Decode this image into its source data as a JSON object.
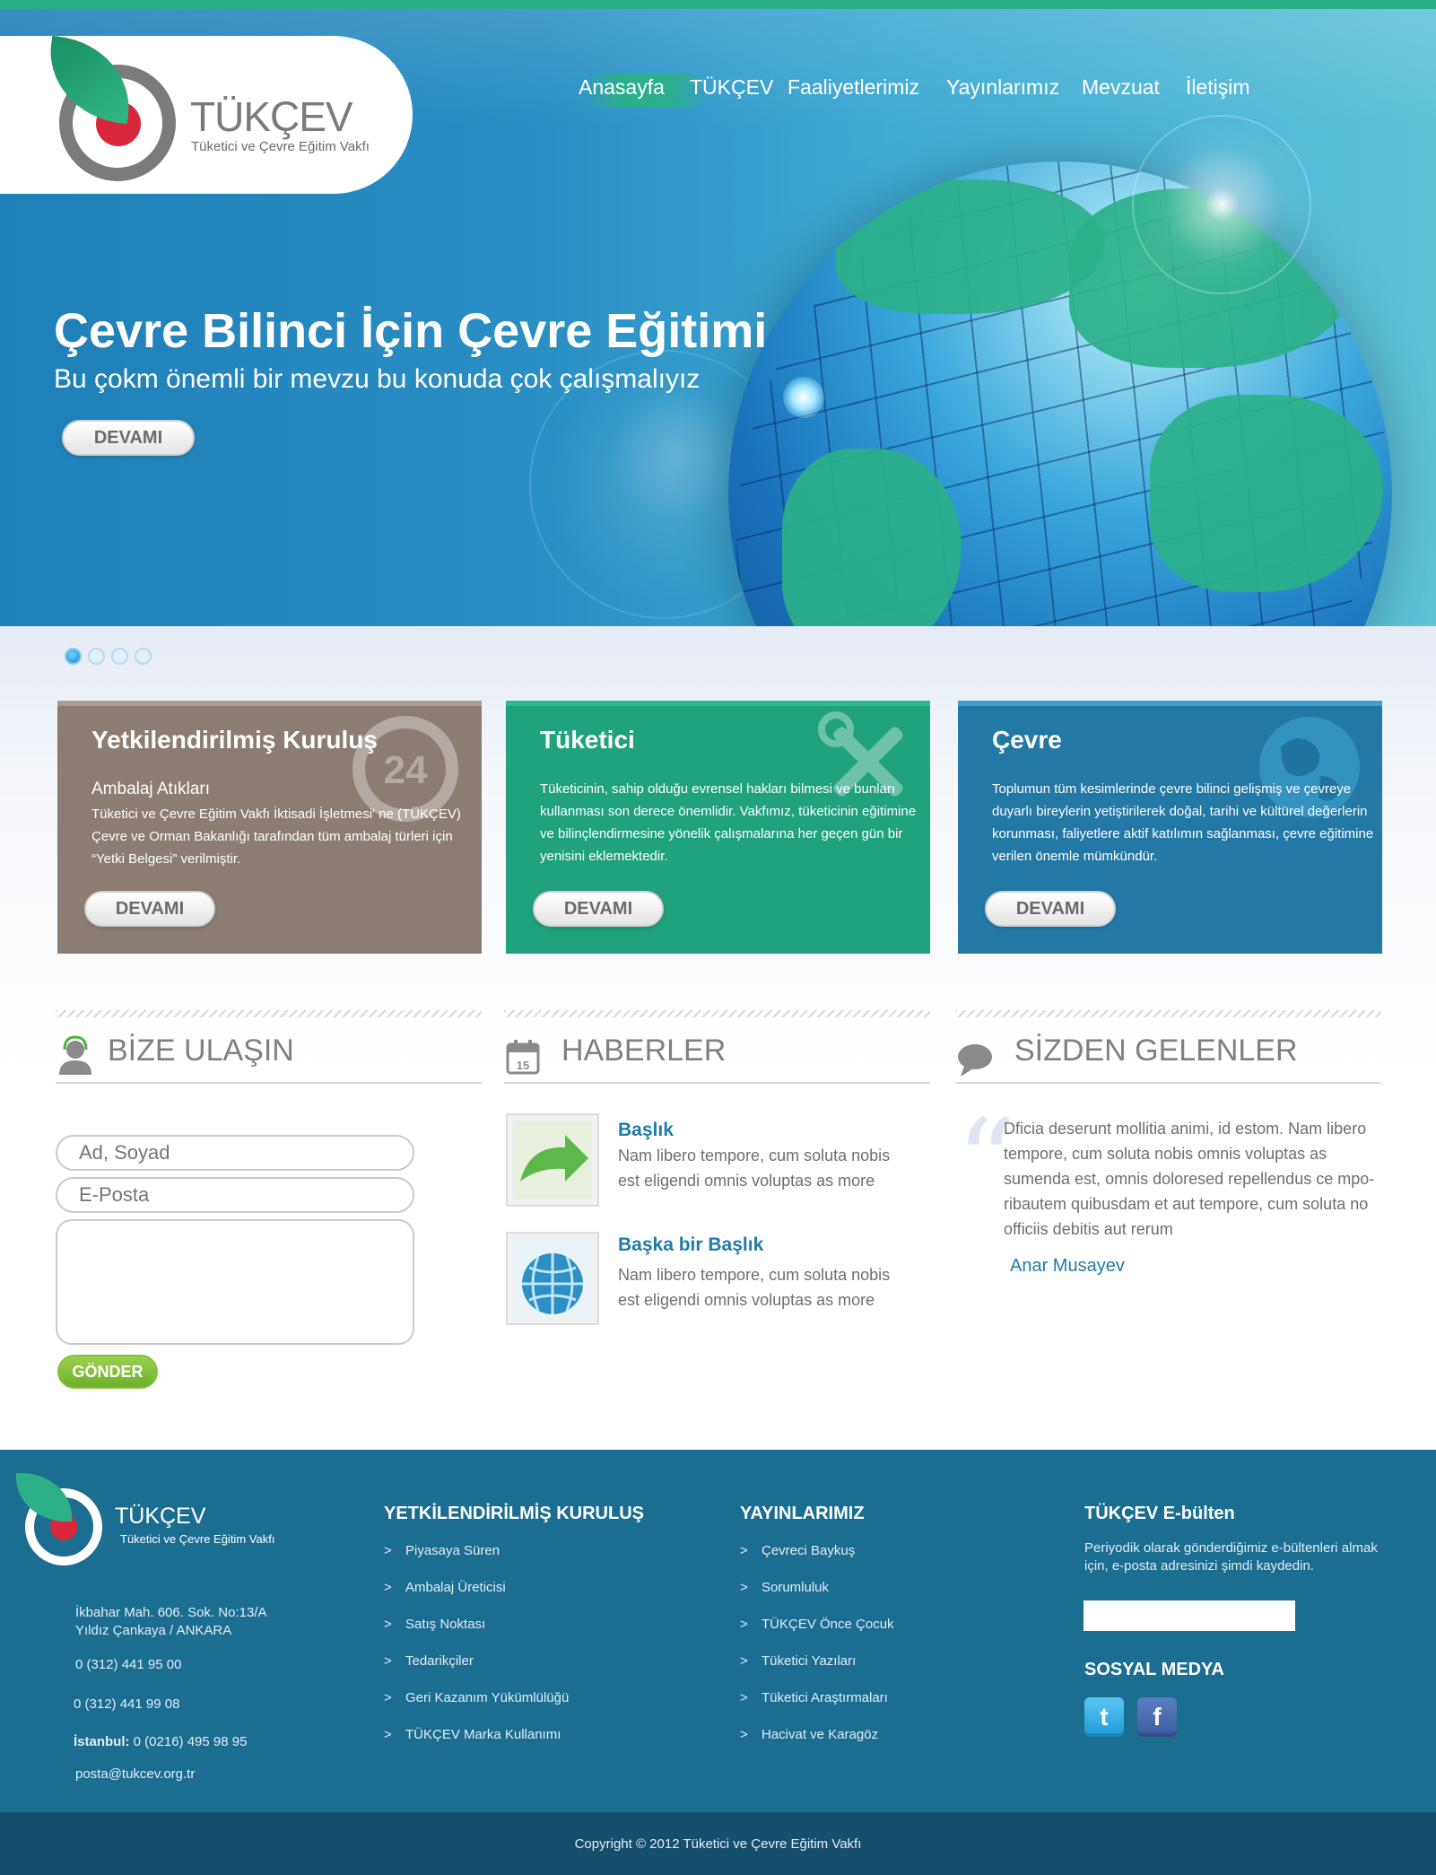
{
  "brand": {
    "name": "TÜKÇEV",
    "tagline": "Tüketici ve  Çevre Eğitim Vakfı",
    "colors": {
      "green": "#2bb08a",
      "blue": "#2478a6",
      "brown": "#8b7d73",
      "red": "#d8263a",
      "footer": "#1b6d91"
    }
  },
  "nav": {
    "items": [
      {
        "label": "Anasayfa",
        "active": true
      },
      {
        "label": "TÜKÇEV",
        "active": false
      },
      {
        "label": "Faaliyetlerimiz",
        "active": false
      },
      {
        "label": "Yayınlarımız",
        "active": false
      },
      {
        "label": "Mevzuat",
        "active": false
      },
      {
        "label": "İletişim",
        "active": false
      }
    ]
  },
  "hero": {
    "title": "Çevre Bilinci İçin  Çevre Eğitimi",
    "subtitle": "Bu çokm önemli bir mevzu bu konuda çok çalışmalıyız",
    "button": "DEVAMI",
    "slides": 4,
    "active_slide": 1
  },
  "features": [
    {
      "title": "Yetkilendirilmiş Kuruluş",
      "subtitle": "Ambalaj Atıkları",
      "text": "Tüketici ve Çevre Eğitim Vakfı İktisadi İşletmesi' ne (TÜKÇEV) Çevre ve Orman Bakanlığı tarafından tüm ambalaj türleri için “Yetki Belgesi” verilmiştir.",
      "button": "DEVAMI",
      "icon": "24-hour-icon"
    },
    {
      "title": "Tüketici",
      "text": "Tüketicinin, sahip olduğu evrensel hakları bilmesi ve bunları kullanması son derece önemlidir. Vakfımız, tüketicinin eğitimine ve bilinçlendirmesine yönelik çalışmalarına her geçen gün bir yenisini eklemektedir.",
      "button": "DEVAMI",
      "icon": "tools-icon"
    },
    {
      "title": "Çevre",
      "text": "Toplumun tüm kesimlerinde çevre bilinci gelişmiş ve çevreye duyarlı bireylerin yetiştirilerek doğal, tarihi ve kültürel değerlerin korunması, faliyetlere aktif katılımın sağlanması, çevre eğitimine verilen önemle mümkündür.",
      "button": "DEVAMI",
      "icon": "globe-icon"
    }
  ],
  "contact": {
    "title": "BİZE ULAŞIN",
    "name_placeholder": "Ad, Soyad",
    "email_placeholder": "E-Posta",
    "message_placeholder": "",
    "submit": "GÖNDER"
  },
  "news": {
    "title": "HABERLER",
    "calendar_day": "15",
    "items": [
      {
        "title": "Başlık",
        "text": "Nam libero tempore, cum soluta nobis est eligendi omnis voluptas as more"
      },
      {
        "title": "Başka bir Başlık",
        "text": "Nam libero tempore, cum soluta nobis est eligendi omnis voluptas as more"
      }
    ]
  },
  "testimonials": {
    "title": "SİZDEN GELENLER",
    "quote": "Dficia deserunt mollitia animi, id estom. Nam libero tempore, cum soluta nobis omnis voluptas as sumenda est, omnis doloresed repellendus ce mpo-ribautem quibusdam et aut tempore, cum soluta no officiis debitis aut rerum",
    "author": "Anar Musayev"
  },
  "footer": {
    "address_line1": "İkbahar Mah. 606. Sok. No:13/A",
    "address_line2": "Yıldız Çankaya / ANKARA",
    "phone1": "0 (312) 441 95 00",
    "phone2": "0 (312) 441 99 08",
    "istanbul_label": "İstanbul:",
    "istanbul_phone": "0 (0216) 495 98 95",
    "email": "posta@tukcev.org.tr",
    "col1_title": "YETKİLENDİRİLMİŞ KURULUŞ",
    "col1_items": [
      "Piyasaya Süren",
      "Ambalaj Üreticisi",
      "Satış Noktası",
      "Tedarikçiler",
      "Geri Kazanım Yükümlülüğü",
      "TÜKÇEV Marka Kullanımı"
    ],
    "col2_title": "YAYINLARIMIZ",
    "col2_items": [
      "Çevreci Baykuş",
      "Sorumluluk",
      "TÜKÇEV Önce Çocuk",
      "Tüketici Yazıları",
      "Tüketici Araştırmaları",
      "Hacivat ve Karagöz"
    ],
    "chevron": ">",
    "newsletter_title": "TÜKÇEV E-bülten",
    "newsletter_text": "Periyodik olarak gönderdiğimiz e-bültenleri almak için, e-posta adresinizi şimdi kaydedin.",
    "newsletter_value": "",
    "social_title": "SOSYAL MEDYA",
    "twitter_glyph": "t",
    "facebook_glyph": "f",
    "copyright": "Copyright © 2012 Tüketici ve Çevre Eğitim Vakfı"
  }
}
